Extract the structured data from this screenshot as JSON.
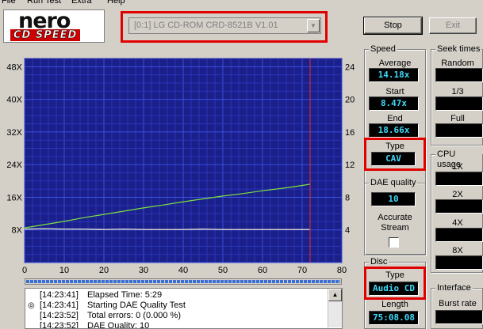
{
  "menu": [
    "File",
    "Run Test",
    "Extra",
    "Help"
  ],
  "logo": {
    "top": "nero",
    "bottom": "CD SPEED"
  },
  "drive_select": {
    "value": "[0:1]  LG CD-ROM CRD-8521B V1.01"
  },
  "buttons": {
    "stop": "Stop",
    "exit": "Exit"
  },
  "chart_data": {
    "type": "line",
    "x": [
      0,
      5,
      10,
      15,
      20,
      25,
      30,
      35,
      40,
      45,
      50,
      55,
      60,
      65,
      70,
      72
    ],
    "xlim": [
      0,
      80
    ],
    "x_ticks": [
      "0",
      "10",
      "20",
      "30",
      "40",
      "50",
      "60",
      "70",
      "80"
    ],
    "y_left_ticks": [
      "8X",
      "16X",
      "24X",
      "32X",
      "40X",
      "48X"
    ],
    "y_left_lim": [
      0,
      50
    ],
    "y_right_ticks": [
      "4",
      "8",
      "12",
      "16",
      "20",
      "24"
    ],
    "y_right_lim": [
      0,
      25
    ],
    "series": [
      {
        "values": [
          8.5,
          9.3,
          10.1,
          11.0,
          11.8,
          12.6,
          13.4,
          14.1,
          14.9,
          15.6,
          16.3,
          16.9,
          17.6,
          18.2,
          18.9,
          19.2
        ],
        "color": "#7ce23c"
      },
      {
        "values": [
          8.2,
          8.3,
          8.2,
          8.2,
          8.1,
          8.2,
          8.1,
          8.1,
          8.1,
          8.2,
          8.1,
          8.1,
          8.1,
          8.1,
          8.1,
          8.1
        ],
        "color": "#fffacd"
      }
    ],
    "marker_x": 72,
    "grid": true,
    "background": "#1b1f8a"
  },
  "progress": {
    "fraction": 1.0
  },
  "log": [
    {
      "time": "[14:23:41]",
      "msg": "Elapsed Time:  5:29",
      "icon": ""
    },
    {
      "time": "[14:23:41]",
      "msg": "Starting DAE Quality Test",
      "icon": "disc-icon"
    },
    {
      "time": "[14:23:52]",
      "msg": "Total errors: 0 (0.000 %)",
      "icon": ""
    },
    {
      "time": "[14:23:52]",
      "msg": "DAE Quality: 10",
      "icon": ""
    }
  ],
  "speed": {
    "title": "Speed",
    "average_label": "Average",
    "average": "14.18x",
    "start_label": "Start",
    "start": "8.47x",
    "end_label": "End",
    "end": "18.66x",
    "type_label": "Type",
    "type": "CAV"
  },
  "dae": {
    "title": "DAE quality",
    "value": "10",
    "accurate_label": "Accurate",
    "stream_label": "Stream",
    "accurate_stream": false
  },
  "disc": {
    "title": "Disc",
    "type_label": "Type",
    "type": "Audio CD",
    "length_label": "Length",
    "length": "75:08.08"
  },
  "seek": {
    "title": "Seek times",
    "random": "Random",
    "third": "1/3",
    "full": "Full"
  },
  "cpu": {
    "title": "CPU usage",
    "x1": "1X",
    "x2": "2X",
    "x4": "4X",
    "x8": "8X"
  },
  "interface": {
    "title": "Interface",
    "burst_label": "Burst rate"
  }
}
